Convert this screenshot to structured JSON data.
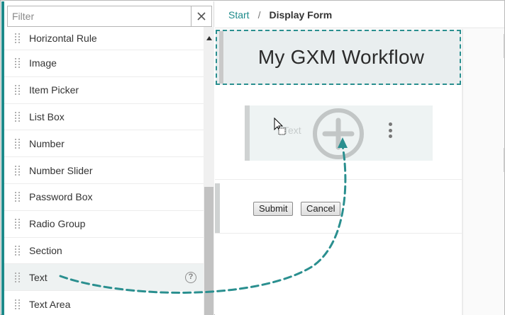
{
  "filter": {
    "placeholder": "Filter",
    "value": ""
  },
  "sidebar": {
    "items": [
      {
        "label": "Horizontal Rule"
      },
      {
        "label": "Image"
      },
      {
        "label": "Item Picker"
      },
      {
        "label": "List Box"
      },
      {
        "label": "Number"
      },
      {
        "label": "Number Slider"
      },
      {
        "label": "Password Box"
      },
      {
        "label": "Radio Group"
      },
      {
        "label": "Section"
      },
      {
        "label": "Text",
        "highlighted": true,
        "help": "?"
      },
      {
        "label": "Text Area"
      }
    ]
  },
  "breadcrumb": {
    "start": "Start",
    "separator": "/",
    "current": "Display Form"
  },
  "form": {
    "title": "My GXM Workflow",
    "drop_placeholder": "Text",
    "submit_label": "Submit",
    "cancel_label": "Cancel"
  },
  "icons": {
    "filter_clear": "close-icon",
    "drag_handle": "grip-icon",
    "help": "help-icon",
    "drop_target": "plus-icon",
    "more": "kebab-icon",
    "cursor": "drag-cursor-icon"
  },
  "colors": {
    "accent": "#1e8b8b",
    "arrow": "#2a8f8f",
    "title_bg": "#e9eeef",
    "drop_bg": "#eef3f3"
  }
}
